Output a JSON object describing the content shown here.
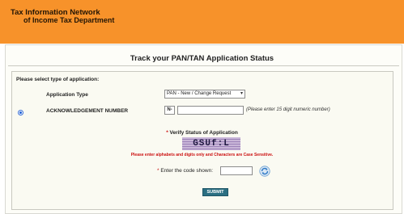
{
  "header": {
    "title": "Tax Information Network",
    "subtitle": "of Income Tax Department",
    "bg_color": "#f7922a"
  },
  "page": {
    "title": "Track your PAN/TAN Application Status"
  },
  "form": {
    "prompt": "Please select type of application:",
    "application_type_label": "Application Type",
    "application_type_value": "PAN - New / Change Request",
    "ack_label": "ACKNOWLEDGEMENT NUMBER",
    "ack_prefix": "N-",
    "ack_value": "",
    "ack_hint": "(Please enter 15 digit numeric number)",
    "verify_required_mark": "*",
    "verify_label": "Verify Status of Application",
    "captcha_text": "GSUf:L",
    "captcha_warning": "Please enter alphabets and digits only and Characters are Case Sensitive.",
    "code_required_mark": "*",
    "code_label": "Enter the code shown:",
    "code_value": "",
    "refresh_icon": "refresh-icon",
    "submit_label": "SUBMIT",
    "submit_color": "#2b6f82"
  }
}
